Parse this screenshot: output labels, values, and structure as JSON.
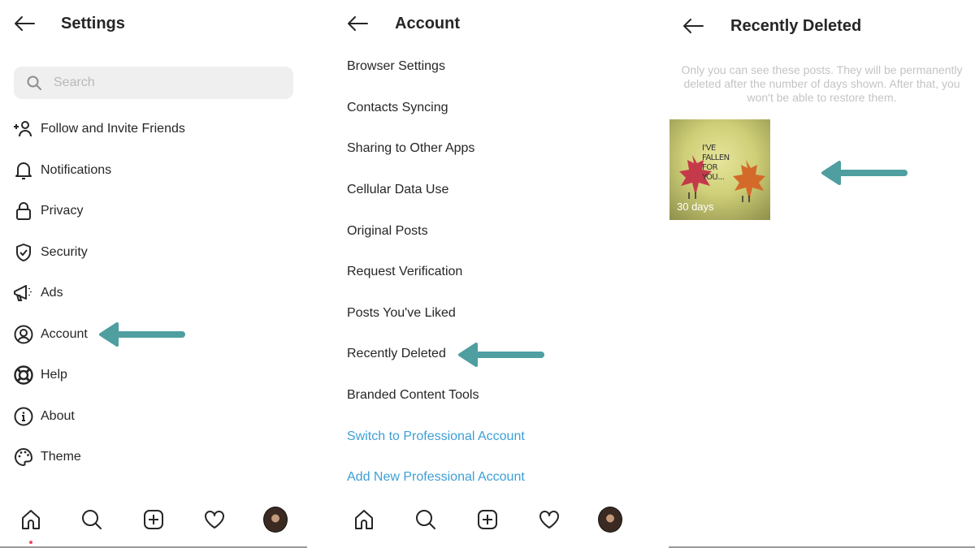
{
  "accent_arrow_color": "#4f9ea0",
  "link_color": "#3d9fd6",
  "settings": {
    "title": "Settings",
    "back_icon": "arrow-left-icon",
    "search": {
      "placeholder": "Search",
      "value": ""
    },
    "items": [
      {
        "label": "Follow and Invite Friends",
        "icon": "add-person-icon"
      },
      {
        "label": "Notifications",
        "icon": "bell-icon"
      },
      {
        "label": "Privacy",
        "icon": "lock-icon"
      },
      {
        "label": "Security",
        "icon": "shield-check-icon"
      },
      {
        "label": "Ads",
        "icon": "megaphone-icon"
      },
      {
        "label": "Account",
        "icon": "user-circle-icon"
      },
      {
        "label": "Help",
        "icon": "lifebuoy-icon"
      },
      {
        "label": "About",
        "icon": "info-icon"
      },
      {
        "label": "Theme",
        "icon": "palette-icon"
      }
    ]
  },
  "account": {
    "title": "Account",
    "back_icon": "arrow-left-icon",
    "items": [
      {
        "label": "Browser Settings"
      },
      {
        "label": "Contacts Syncing"
      },
      {
        "label": "Sharing to Other Apps"
      },
      {
        "label": "Cellular Data Use"
      },
      {
        "label": "Original Posts"
      },
      {
        "label": "Request Verification"
      },
      {
        "label": "Posts You've Liked"
      },
      {
        "label": "Recently Deleted"
      },
      {
        "label": "Branded Content Tools"
      },
      {
        "label": "Switch to Professional Account",
        "link": true
      },
      {
        "label": "Add New Professional Account",
        "link": true
      }
    ]
  },
  "recently_deleted": {
    "title": "Recently Deleted",
    "back_icon": "arrow-left-icon",
    "info": "Only you can see these posts. They will be permanently deleted after the number of days shown. After that, you won't be able to restore them.",
    "posts": [
      {
        "caption": "I'VE FALLEN FOR YOU...",
        "days_left": "30 days"
      }
    ]
  },
  "bottom_nav": [
    "home-icon",
    "search-icon",
    "new-post-icon",
    "heart-icon",
    "profile-avatar"
  ]
}
